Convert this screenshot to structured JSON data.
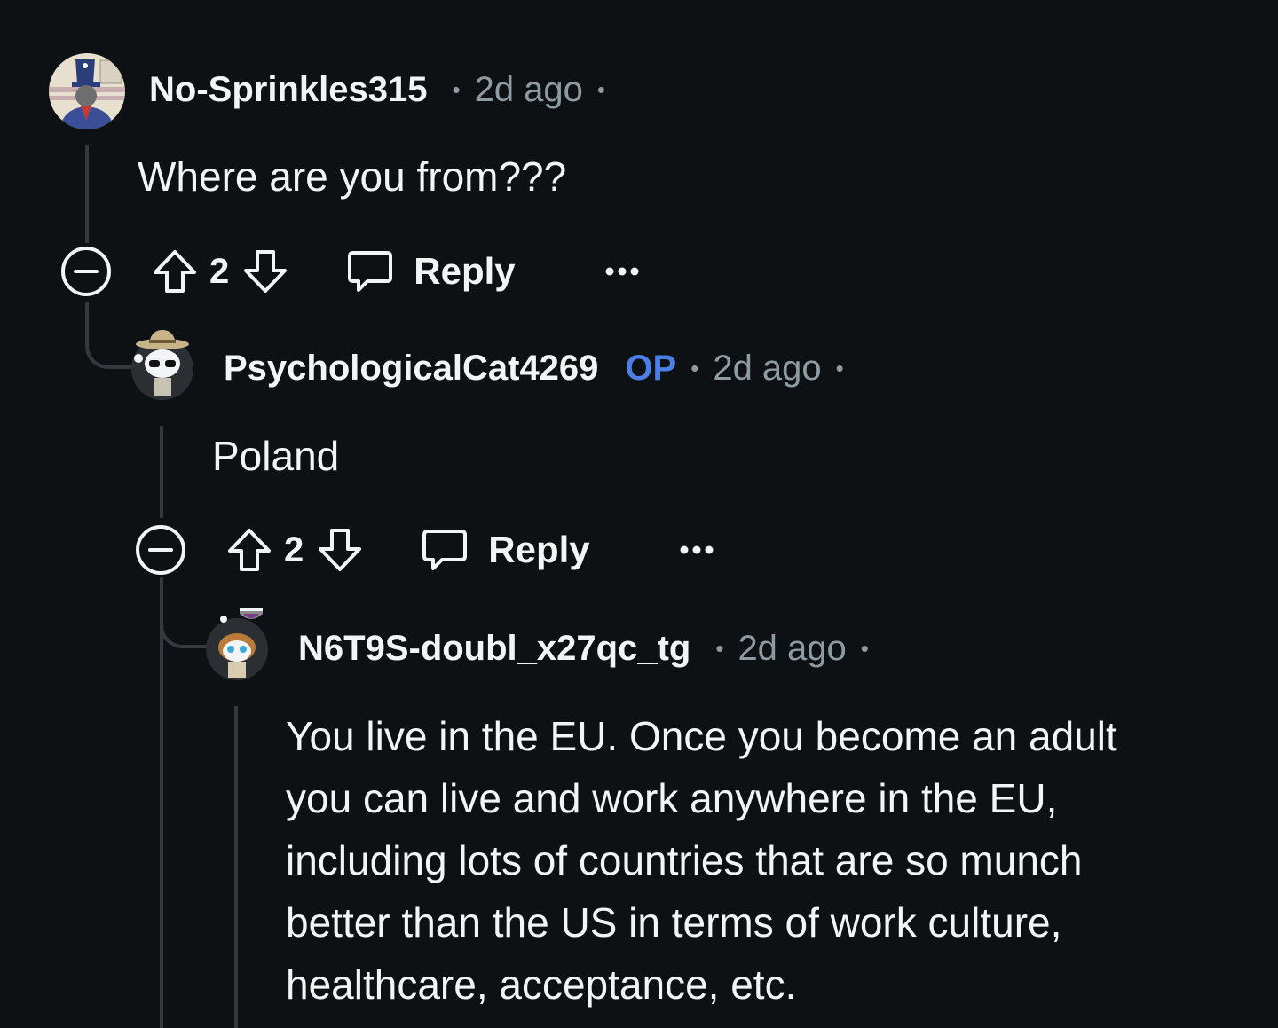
{
  "comments": [
    {
      "username": "No-Sprinkles315",
      "op_badge": "",
      "time": "2d ago",
      "body": "Where are you from???",
      "votes": "2",
      "reply_label": "Reply"
    },
    {
      "username": "PsychologicalCat4269",
      "op_badge": "OP",
      "time": "2d ago",
      "body": "Poland",
      "votes": "2",
      "reply_label": "Reply"
    },
    {
      "username": "N6T9S-doubl_x27qc_tg",
      "op_badge": "",
      "time": "2d ago",
      "body_lines": [
        "You live in the EU. Once you become an adult",
        "you can live and work anywhere in the EU,",
        "including lots of countries that are so munch",
        "better than the US in terms of work culture,",
        "healthcare, acceptance, etc."
      ]
    }
  ],
  "colors": {
    "background": "#0e1113",
    "text": "#f2f4f5",
    "meta": "#8f9ba3",
    "op": "#4b7fe6",
    "thread_line": "#33393d"
  }
}
